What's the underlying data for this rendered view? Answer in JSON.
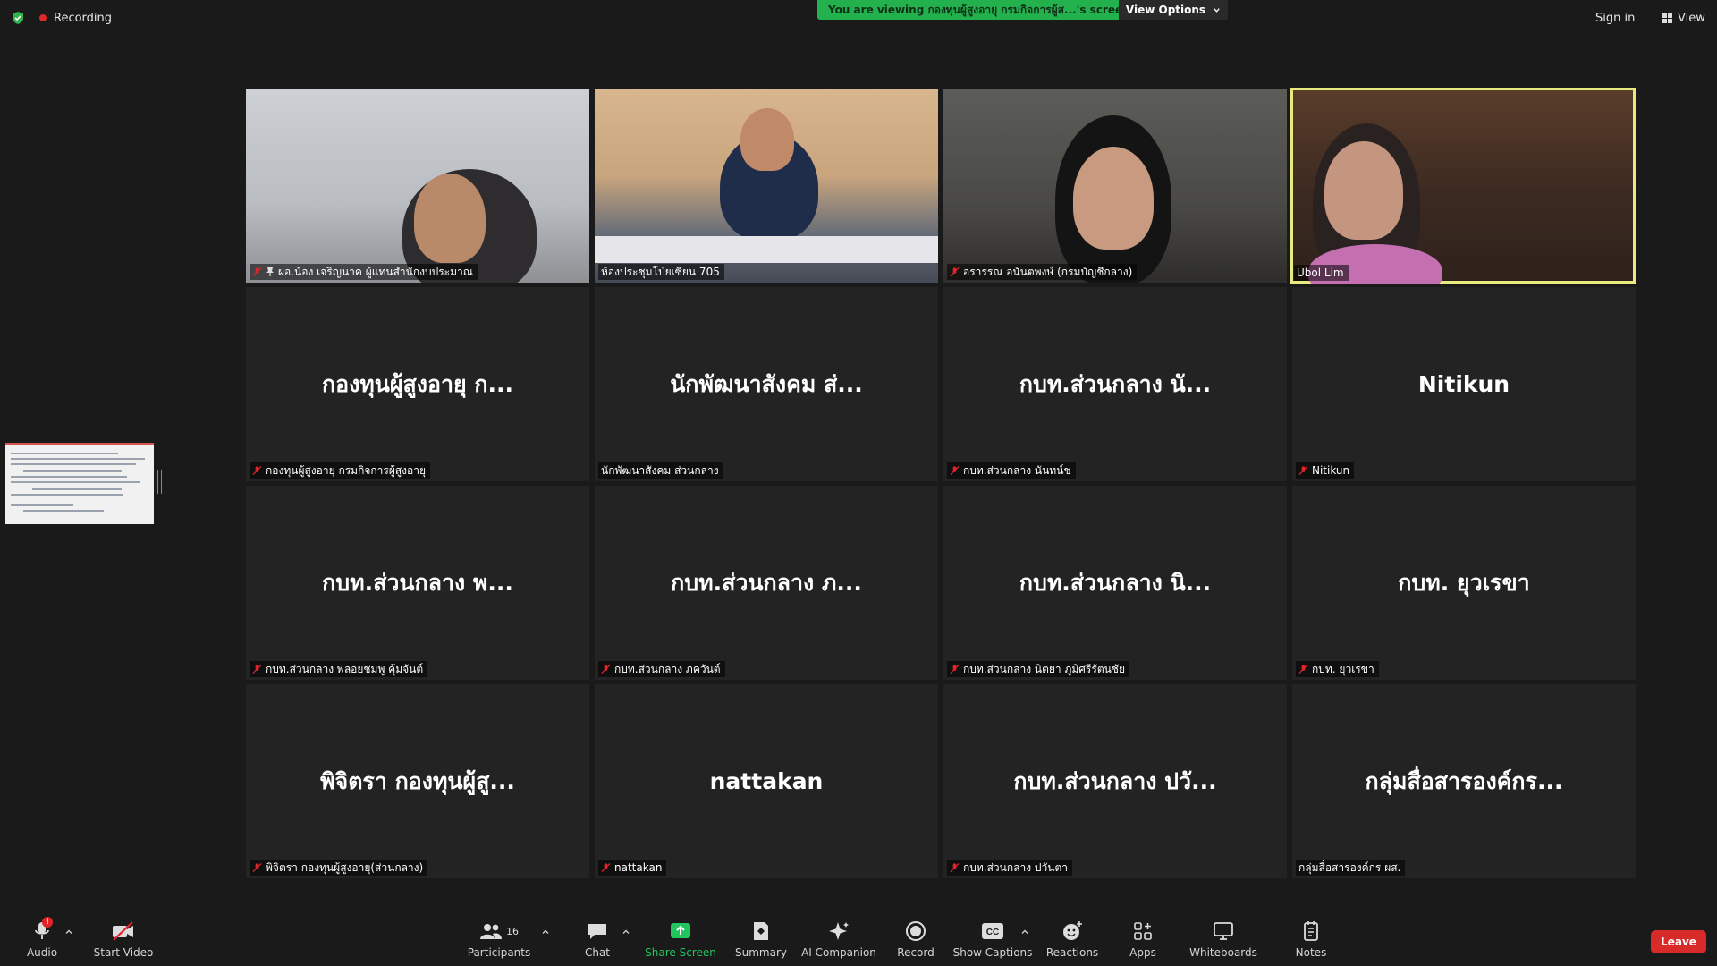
{
  "top_bar": {
    "recording_label": "Recording",
    "viewing_banner": "You are viewing กองทุนผู้สูงอายุ กรมกิจการผู้ส...'s screen",
    "view_options_label": "View Options",
    "sign_in_label": "Sign in",
    "view_label": "View"
  },
  "tiles": [
    {
      "name": "ผอ.น้อง  เจริญนาค ผู้แทนสำนักงบประมาณ",
      "video": true,
      "muted": true,
      "pinned": true
    },
    {
      "name": "ห้องประชุมโป่ยเซียน 705",
      "video": true,
      "muted": false,
      "pinned": false
    },
    {
      "name": "อรารรณ อนันตพงษ์ (กรมบัญชีกลาง)",
      "video": true,
      "muted": true,
      "pinned": false
    },
    {
      "name": "Ubol Lim",
      "video": true,
      "muted": false,
      "pinned": false,
      "active_speaker": true
    },
    {
      "display": "กองทุนผู้สูงอายุ ก...",
      "name": "กองทุนผู้สูงอายุ กรมกิจการผู้สูงอายุ",
      "video": false,
      "muted": true
    },
    {
      "display": "นักพัฒนาสังคม ส่...",
      "name": "นักพัฒนาสังคม ส่วนกลาง",
      "video": false,
      "muted": false
    },
    {
      "display": "กบท.ส่วนกลาง นั...",
      "name": "กบท.ส่วนกลาง นันทน์ช",
      "video": false,
      "muted": true
    },
    {
      "display": "Nitikun",
      "name": "Nitikun",
      "video": false,
      "muted": true
    },
    {
      "display": "กบท.ส่วนกลาง พ...",
      "name": "กบท.ส่วนกลาง พลอยชมพู คุ้มจันต์",
      "video": false,
      "muted": true
    },
    {
      "display": "กบท.ส่วนกลาง ภ...",
      "name": "กบท.ส่วนกลาง ภควันต์",
      "video": false,
      "muted": true
    },
    {
      "display": "กบท.ส่วนกลาง นิ...",
      "name": "กบท.ส่วนกลาง นิตยา ภูมิศรีรัตนชัย",
      "video": false,
      "muted": true
    },
    {
      "display": "กบท. ยุวเรขา",
      "name": "กบท. ยุวเรขา",
      "video": false,
      "muted": true
    },
    {
      "display": "พิจิตรา กองทุนผู้สู...",
      "name": "พิจิตรา กองทุนผู้สูงอายุ(ส่วนกลาง)",
      "video": false,
      "muted": true
    },
    {
      "display": "nattakan",
      "name": "nattakan",
      "video": false,
      "muted": true
    },
    {
      "display": "กบท.ส่วนกลาง ปวั...",
      "name": "กบท.ส่วนกลาง ปวันตา",
      "video": false,
      "muted": true
    },
    {
      "display": "กลุ่มสื่อสารองค์กร...",
      "name": "กลุ่มสื่อสารองค์กร ผส.",
      "video": false,
      "muted": false
    }
  ],
  "toolbar": {
    "audio_label": "Audio",
    "audio_badge": "!",
    "video_label": "Start Video",
    "participants_label": "Participants",
    "participants_count": "16",
    "chat_label": "Chat",
    "share_label": "Share Screen",
    "summary_label": "Summary",
    "ai_label": "AI Companion",
    "record_label": "Record",
    "captions_label": "Show Captions",
    "captions_icon_text": "CC",
    "reactions_label": "Reactions",
    "apps_label": "Apps",
    "whiteboards_label": "Whiteboards",
    "notes_label": "Notes",
    "leave_label": "Leave"
  },
  "colors": {
    "background": "#1a1a1a",
    "tile": "#232323",
    "banner_green": "#23b14d",
    "share_green": "#22c55e",
    "leave_red": "#d92a2a",
    "active_speaker": "#e9ea7d",
    "mute_red": "#e0242a"
  }
}
